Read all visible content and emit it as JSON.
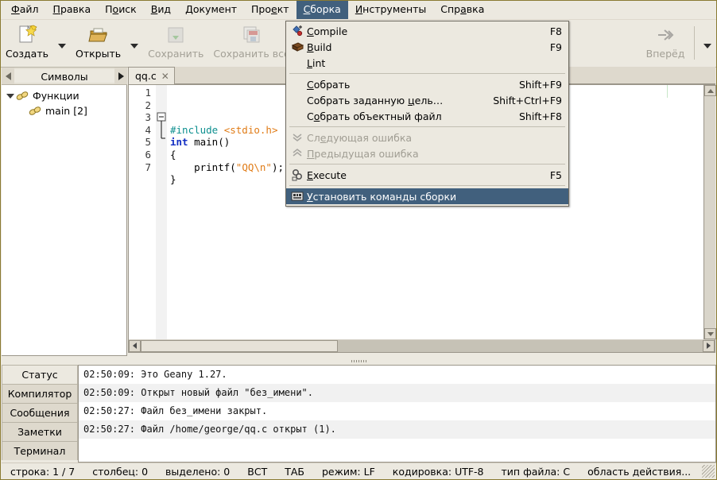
{
  "menubar": {
    "items": [
      {
        "label": "Файл",
        "mnemonic": "Ф",
        "active": false
      },
      {
        "label": "Правка",
        "mnemonic": "П",
        "active": false
      },
      {
        "label": "Поиск",
        "mnemonic": "о",
        "active": false
      },
      {
        "label": "Вид",
        "mnemonic": "В",
        "active": false
      },
      {
        "label": "Документ",
        "mnemonic": "Д",
        "active": false
      },
      {
        "label": "Проект",
        "mnemonic": "е",
        "active": false
      },
      {
        "label": "Сборка",
        "mnemonic": "С",
        "active": true
      },
      {
        "label": "Инструменты",
        "mnemonic": "И",
        "active": false
      },
      {
        "label": "Справка",
        "mnemonic": "а",
        "active": false
      }
    ]
  },
  "toolbar": {
    "buttons": [
      {
        "label": "Создать",
        "icon": "new-file-icon",
        "disabled": false,
        "has_arrow": true
      },
      {
        "label": "Открыть",
        "icon": "open-folder-icon",
        "disabled": false,
        "has_arrow": true
      },
      {
        "label": "Сохранить",
        "icon": "save-icon",
        "disabled": true,
        "has_arrow": false
      },
      {
        "label": "Сохранить всё",
        "icon": "save-all-icon",
        "disabled": true,
        "has_arrow": false
      },
      {
        "label": "Вперёд",
        "icon": "forward-arrow-icon",
        "disabled": true,
        "has_arrow": false
      }
    ],
    "overflow_label": "toolbar-overflow"
  },
  "build_menu": {
    "title": "Сборка",
    "items": [
      {
        "label": "Compile",
        "mnemonic": "C",
        "accel": "F8",
        "icon": "compile-icon",
        "disabled": false,
        "selected": false,
        "separator_after": false
      },
      {
        "label": "Build",
        "mnemonic": "B",
        "accel": "F9",
        "icon": "build-brick-icon",
        "disabled": false,
        "selected": false,
        "separator_after": false
      },
      {
        "label": "Lint",
        "mnemonic": "L",
        "accel": "",
        "icon": "",
        "disabled": false,
        "selected": false,
        "separator_after": true
      },
      {
        "label": "Собрать",
        "mnemonic": "С",
        "accel": "Shift+F9",
        "icon": "",
        "disabled": false,
        "selected": false,
        "separator_after": false
      },
      {
        "label": "Собрать заданную цель…",
        "mnemonic": "ц",
        "accel": "Shift+Ctrl+F9",
        "icon": "",
        "disabled": false,
        "selected": false,
        "separator_after": false
      },
      {
        "label": "Собрать объектный файл",
        "mnemonic": "о",
        "accel": "Shift+F8",
        "icon": "",
        "disabled": false,
        "selected": false,
        "separator_after": true
      },
      {
        "label": "Следующая ошибка",
        "mnemonic": "е",
        "accel": "",
        "icon": "next-error-icon",
        "disabled": true,
        "selected": false,
        "separator_after": false
      },
      {
        "label": "Предыдущая ошибка",
        "mnemonic": "П",
        "accel": "",
        "icon": "prev-error-icon",
        "disabled": true,
        "selected": false,
        "separator_after": true
      },
      {
        "label": "Execute",
        "mnemonic": "E",
        "accel": "F5",
        "icon": "execute-gears-icon",
        "disabled": false,
        "selected": false,
        "separator_after": true
      },
      {
        "label": "Установить команды сборки",
        "mnemonic": "У",
        "accel": "",
        "icon": "set-build-commands-icon",
        "disabled": false,
        "selected": true,
        "separator_after": false
      }
    ]
  },
  "sidebar": {
    "tab_label": "Символы",
    "tree": [
      {
        "label": "Функции",
        "depth": 0,
        "expanded": true,
        "icon": "chain-icon"
      },
      {
        "label": "main [2]",
        "depth": 1,
        "expanded": null,
        "icon": "chain-icon"
      }
    ]
  },
  "editor": {
    "tab": {
      "label": "qq.c",
      "close_label": "✕"
    },
    "line_numbers": [
      "1",
      "2",
      "3",
      "4",
      "5",
      "6",
      "7"
    ],
    "lines": [
      [
        {
          "t": "#include ",
          "c": "k-prep"
        },
        {
          "t": "<stdio.h>",
          "c": "k-inc"
        }
      ],
      [
        {
          "t": "int",
          "c": "k-kw"
        },
        {
          "t": " main()",
          "c": "k-plain"
        }
      ],
      [
        {
          "t": "{",
          "c": "k-plain"
        }
      ],
      [
        {
          "t": "    printf(",
          "c": "k-plain"
        },
        {
          "t": "\"QQ\\n\"",
          "c": "k-str"
        },
        {
          "t": ");",
          "c": "k-plain"
        }
      ],
      [
        {
          "t": "}",
          "c": "k-plain"
        }
      ],
      [],
      []
    ]
  },
  "message_panel": {
    "tabs": [
      {
        "label": "Статус",
        "selected": true
      },
      {
        "label": "Компилятор",
        "selected": false
      },
      {
        "label": "Сообщения",
        "selected": false
      },
      {
        "label": "Заметки",
        "selected": false
      },
      {
        "label": "Терминал",
        "selected": false
      }
    ],
    "rows": [
      {
        "time": "02:50:09:",
        "text": "Это Geany 1.27."
      },
      {
        "time": "02:50:09:",
        "text": "Открыт новый файл \"без_имени\"."
      },
      {
        "time": "02:50:27:",
        "text": "Файл без_имени закрыт."
      },
      {
        "time": "02:50:27:",
        "text": "Файл /home/george/qq.c открыт (1)."
      }
    ]
  },
  "statusbar": {
    "items": [
      "строка: 1 / 7",
      "столбец: 0",
      "выделено: 0",
      "ВСТ",
      "ТАБ",
      "режим: LF",
      "кодировка: UTF-8",
      "тип файла: C",
      "область действия..."
    ]
  },
  "colors": {
    "menu_highlight": "#41607d",
    "window_bg": "#ece9e0",
    "border": "#8a7a32",
    "keyword": "#1430c4",
    "preprocessor": "#0d8f8f",
    "string": "#e07b16"
  }
}
